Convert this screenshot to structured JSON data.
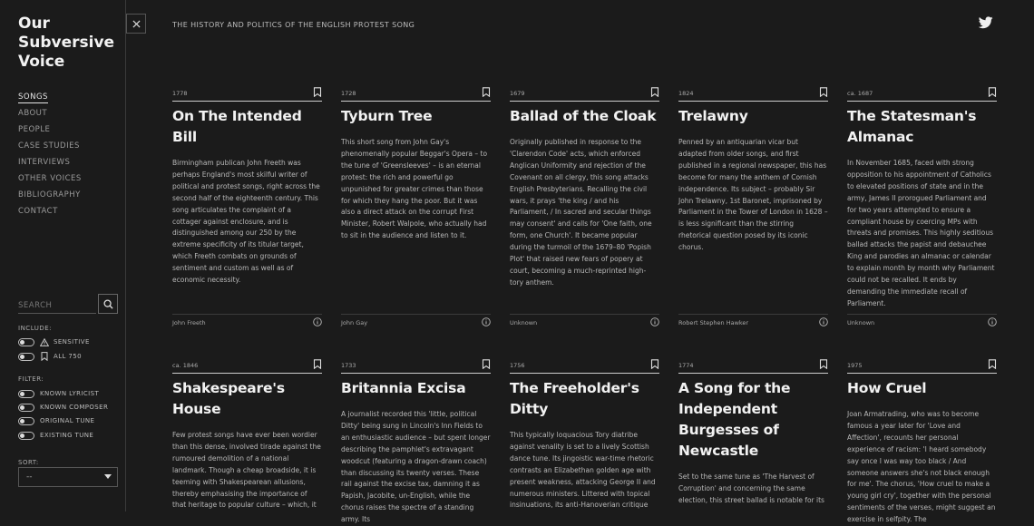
{
  "site": {
    "logo": "Our\nSubversive\nVoice",
    "header_title": "THE HISTORY AND POLITICS OF THE ENGLISH PROTEST SONG"
  },
  "nav": [
    "SONGS",
    "ABOUT",
    "PEOPLE",
    "CASE STUDIES",
    "INTERVIEWS",
    "OTHER VOICES",
    "BIBLIOGRAPHY",
    "CONTACT"
  ],
  "search": {
    "placeholder": "SEARCH"
  },
  "include": {
    "label": "INCLUDE:",
    "items": [
      "SENSITIVE",
      "ALL 750"
    ]
  },
  "filter": {
    "label": "FILTER:",
    "items": [
      "KNOWN LYRICIST",
      "KNOWN COMPOSER",
      "ORIGINAL TUNE",
      "EXISTING TUNE"
    ]
  },
  "sort": {
    "label": "SORT:",
    "value": "--"
  },
  "songs": [
    {
      "year": "1778",
      "title": "On The Intended Bill",
      "desc": "Birmingham publican John Freeth was perhaps England's most skilful writer of political and protest songs, right across the second half of the eighteenth century. This song articulates the complaint of a cottager against enclosure, and is distinguished among our 250 by the extreme specificity of its titular target, which Freeth combats on grounds of sentiment and custom as well as of economic necessity.",
      "author": "John Freeth"
    },
    {
      "year": "1728",
      "title": "Tyburn Tree",
      "desc": "This short song from John Gay's phenomenally popular Beggar's Opera – to the tune of 'Greensleeves' – is an eternal protest: the rich and powerful go unpunished for greater crimes than those for which they hang the poor. But it was also a direct attack on the corrupt First Minister, Robert Walpole, who actually had to sit in the audience and listen to it.",
      "author": "John Gay"
    },
    {
      "year": "1679",
      "title": "Ballad of the Cloak",
      "desc": "Originally published in response to the 'Clarendon Code' acts, which enforced Anglican Uniformity and rejection of the Covenant on all clergy, this song attacks English Presbyterians. Recalling the civil wars, it prays 'the king / and his Parliament, / In sacred and secular things may consent' and calls for 'One faith, one form, one Church'. It became popular during the turmoil of the 1679–80 'Popish Plot' that raised new fears of popery at court, becoming a much-reprinted high-tory anthem.",
      "author": "Unknown"
    },
    {
      "year": "1824",
      "title": "Trelawny",
      "desc": "Penned by an antiquarian vicar but adapted from older songs, and first published in a regional newspaper, this has become for many the anthem of Cornish independence. Its subject – probably Sir John Trelawny, 1st Baronet, imprisoned by Parliament in the Tower of London in 1628 – is less significant than the stirring rhetorical question posed by its iconic chorus.",
      "author": "Robert Stephen Hawker"
    },
    {
      "year": "ca. 1687",
      "title": "The Statesman's Almanac",
      "desc": "In November 1685, faced with strong opposition to his appointment of Catholics to elevated positions of state and in the army, James II prorogued Parliament and for two years attempted to ensure a compliant house by coercing MPs with threats and promises. This highly seditious ballad attacks the papist and debauchee King and parodies an almanac or calendar to explain month by month why Parliament could not be recalled. It ends by demanding the immediate recall of Parliament.",
      "author": "Unknown"
    },
    {
      "year": "ca. 1846",
      "title": "Shakespeare's House",
      "desc": "Few protest songs have ever been wordier than this dense, involved tirade against the rumoured demolition of a national landmark. Though a cheap broadside, it is teeming with Shakespearean allusions, thereby emphasising the importance of that heritage to popular culture – which, it",
      "author": ""
    },
    {
      "year": "1733",
      "title": "Britannia Excisa",
      "desc": "A journalist recorded this 'little, political Ditty' being sung in Lincoln's Inn Fields to an enthusiastic audience – but spent longer describing the pamphlet's extravagant woodcut (featuring a dragon-drawn coach) than discussing its twenty verses. These rail against the excise tax, damning it as Papish, Jacobite, un-English, while the chorus raises the spectre of a standing army. Its",
      "author": ""
    },
    {
      "year": "1756",
      "title": "The Freeholder's Ditty",
      "desc": "This typically loquacious Tory diatribe against venality is set to a lively Scottish dance tune. Its jingoistic war-time rhetoric contrasts an Elizabethan golden age with present weakness, attacking George II and numerous ministers. Littered with topical insinuations, its anti-Hanoverian critique",
      "author": ""
    },
    {
      "year": "1774",
      "title": "A Song for the Independent Burgesses of Newcastle",
      "desc": "Set to the same tune as 'The Harvest of Corruption' and concerning the same election, this street ballad is notable for its",
      "author": ""
    },
    {
      "year": "1975",
      "title": "How Cruel",
      "desc": "Joan Armatrading, who was to become famous a year later for 'Love and Affection', recounts her personal experience of racism: 'I heard somebody say once I was way too black / And someone answers she's not black enough for me'. The chorus, 'How cruel to make a young girl cry', together with the personal sentiments of the verses, might suggest an exercise in selfpity. The",
      "author": ""
    }
  ]
}
